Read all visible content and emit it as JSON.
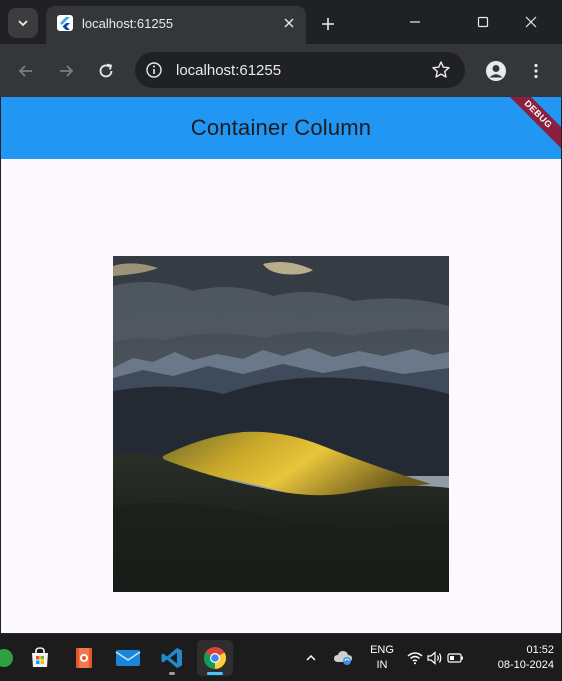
{
  "browser": {
    "tab_title": "localhost:61255",
    "address": "localhost:61255"
  },
  "app": {
    "title": "Container Column",
    "debug_label": "DEBUG",
    "colors": {
      "appbar": "#2196f3",
      "background": "#fdf7fe",
      "debug_banner": "#8b1f3f"
    },
    "image": {
      "description_icon": "landscape-photo"
    }
  },
  "taskbar": {
    "language_line1": "ENG",
    "language_line2": "IN",
    "time": "01:52",
    "date": "08-10-2024"
  }
}
